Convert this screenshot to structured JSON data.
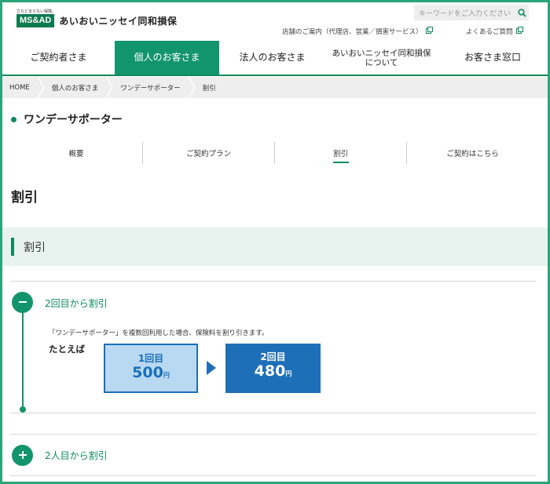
{
  "header": {
    "logo_tagline": "立ちどまらない保険。",
    "logo_mark": "MS&AD",
    "company_name": "あいおいニッセイ同和損保",
    "search_placeholder": "キーワードをご入力ください",
    "util_links": [
      {
        "label": "店舗のご案内（代理店、営業／損害サービス）"
      },
      {
        "label": "よくあるご質問"
      }
    ]
  },
  "global_nav": [
    {
      "label": "ご契約者さま",
      "active": false
    },
    {
      "label": "個人のお客さま",
      "active": true
    },
    {
      "label": "法人のお客さま",
      "active": false
    },
    {
      "label": "あいおいニッセイ同和損保\nについて",
      "active": false
    },
    {
      "label": "お客さま窓口",
      "active": false
    }
  ],
  "breadcrumb": [
    "HOME",
    "個人のお客さま",
    "ワンデーサポーター",
    "割引"
  ],
  "page_title": "ワンデーサポーター",
  "sub_nav": [
    {
      "label": "概要",
      "active": false
    },
    {
      "label": "ご契約プラン",
      "active": false
    },
    {
      "label": "割引",
      "active": true
    },
    {
      "label": "ご契約はこちら",
      "active": false
    }
  ],
  "section_title": "割引",
  "band_title": "割引",
  "accordion": [
    {
      "label": "2回目から割引",
      "expanded": true,
      "description": "「ワンデーサポーター」を複数回利用した場合、保険料を割り引きます。",
      "example_label": "たとえば",
      "before": {
        "label": "1回目",
        "value": "500",
        "unit": "円"
      },
      "after": {
        "label": "2回目",
        "value": "480",
        "unit": "円"
      }
    },
    {
      "label": "2人目から割引",
      "expanded": false
    }
  ],
  "colors": {
    "brand_green": "#12956a",
    "accent_blue": "#1d6fb8",
    "light_blue": "#b9d9f3",
    "band_bg": "#e8f3ef"
  }
}
